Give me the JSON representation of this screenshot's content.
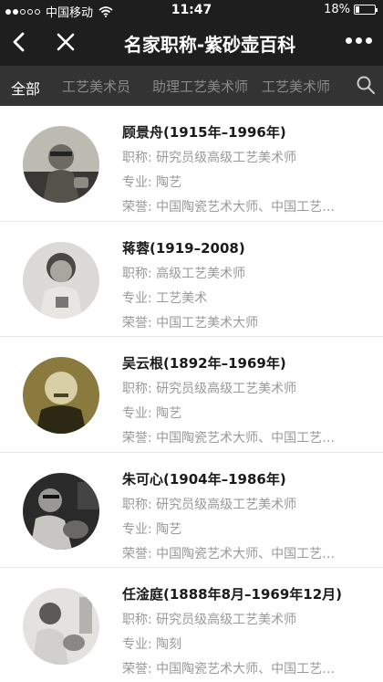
{
  "status_bar": {
    "carrier": "中国移动",
    "time": "11:47",
    "battery": "18%",
    "battery_level": 0.18
  },
  "navbar": {
    "title": "名家职称-紫砂壶百科"
  },
  "tabs": [
    {
      "label": "全部",
      "active": true
    },
    {
      "label": "工艺美术员",
      "active": false
    },
    {
      "label": "助理工艺美术师",
      "active": false
    },
    {
      "label": "工艺美术师",
      "active": false
    }
  ],
  "field_labels": {
    "title": "职称:",
    "major": "专业:",
    "honor": "荣誉:"
  },
  "people": [
    {
      "name": "顾景舟(1915年–1996年)",
      "title": "研究员级高级工艺美术师",
      "major": "陶艺",
      "honor": "中国陶瓷艺术大师、中国工艺美术大师"
    },
    {
      "name": "蒋蓉(1919–2008)",
      "title": "高级工艺美术师",
      "major": "工艺美术",
      "honor": "中国工艺美术大师"
    },
    {
      "name": "吴云根(1892年–1969年)",
      "title": "研究员级高级工艺美术师",
      "major": "陶艺",
      "honor": "中国陶瓷艺术大师、中国工艺美术大师"
    },
    {
      "name": "朱可心(1904年–1986年)",
      "title": "研究员级高级工艺美术师",
      "major": "陶艺",
      "honor": "中国陶瓷艺术大师、中国工艺美术大师"
    },
    {
      "name": "任淦庭(1888年8月–1969年12月)",
      "title": "研究员级高级工艺美术师",
      "major": "陶刻",
      "honor": "中国陶瓷艺术大师、中国工艺美术大师"
    }
  ]
}
